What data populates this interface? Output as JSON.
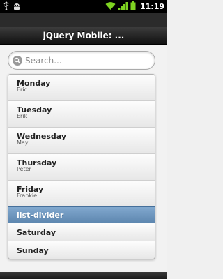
{
  "statusbar": {
    "time": "11:19",
    "left_icons": [
      "usb-icon",
      "android-debug-icon"
    ],
    "right_icons": [
      "wifi-icon",
      "signal-icon",
      "battery-icon"
    ]
  },
  "header": {
    "title": "jQuery Mobile: ..."
  },
  "search": {
    "placeholder": "Search..."
  },
  "list": {
    "items": [
      {
        "primary": "Monday",
        "secondary": "Eric"
      },
      {
        "primary": "Tuesday",
        "secondary": "Erik"
      },
      {
        "primary": "Wednesday",
        "secondary": "May"
      },
      {
        "primary": "Thursday",
        "secondary": "Peter"
      },
      {
        "primary": "Friday",
        "secondary": "Frankie"
      }
    ],
    "divider": "list-divider",
    "after_divider": [
      {
        "primary": "Saturday"
      },
      {
        "primary": "Sunday"
      }
    ]
  },
  "colors": {
    "divider": "#6a93bc",
    "header": "#222222",
    "statusbar": "#000000"
  }
}
